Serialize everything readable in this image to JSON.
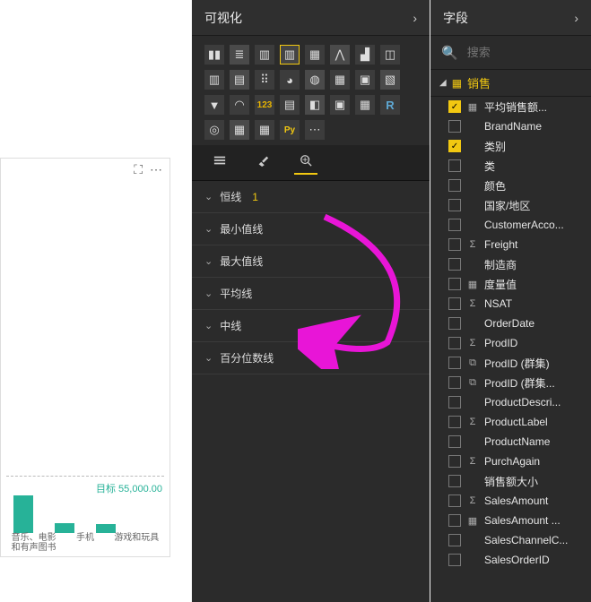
{
  "canvas": {
    "goal_label": "目标 55,000.00",
    "header_icons": [
      "focus-icon",
      "more-icon"
    ],
    "bars": {
      "heights": [
        42,
        11,
        10
      ],
      "labels": [
        "音乐、电影和有声图书",
        "手机",
        "游戏和玩具"
      ]
    }
  },
  "visualizations": {
    "title": "可视化",
    "grid": [
      {
        "n": "stacked-bar-icon",
        "cls": "",
        "g": "▮▮"
      },
      {
        "n": "clustered-bar-icon",
        "cls": "alt1",
        "g": "≣"
      },
      {
        "n": "column-icon",
        "cls": "",
        "g": "▥"
      },
      {
        "n": "stacked-column-icon",
        "cls": "sel",
        "g": "▥"
      },
      {
        "n": "clustered-column-icon",
        "cls": "",
        "g": "▦"
      },
      {
        "n": "line-icon",
        "cls": "alt1",
        "g": "⋀"
      },
      {
        "n": "area-icon",
        "cls": "",
        "g": "▟"
      },
      {
        "n": "combo-icon",
        "cls": "",
        "g": "◫"
      },
      {
        "n": "ribbon-icon",
        "cls": "",
        "g": "▥"
      },
      {
        "n": "waterfall-icon",
        "cls": "alt1",
        "g": "▤"
      },
      {
        "n": "scatter-icon",
        "cls": "",
        "g": "⠿"
      },
      {
        "n": "pie-icon",
        "cls": "",
        "g": "◕"
      },
      {
        "n": "donut-icon",
        "cls": "alt1",
        "g": "◍"
      },
      {
        "n": "treemap-icon",
        "cls": "",
        "g": "▦"
      },
      {
        "n": "map-icon",
        "cls": "",
        "g": "▣"
      },
      {
        "n": "filled-map-icon",
        "cls": "alt1",
        "g": "▧"
      },
      {
        "n": "funnel-icon",
        "cls": "",
        "g": "▼"
      },
      {
        "n": "gauge-icon",
        "cls": "",
        "g": "◠"
      },
      {
        "n": "card-icon",
        "cls": "kpi",
        "g": "123"
      },
      {
        "n": "multicard-icon",
        "cls": "",
        "g": "▤"
      },
      {
        "n": "kpi-icon",
        "cls": "alt1",
        "g": "◧"
      },
      {
        "n": "slicer-icon",
        "cls": "",
        "g": "▣"
      },
      {
        "n": "table-icon",
        "cls": "",
        "g": "▦"
      },
      {
        "n": "matrix-icon",
        "cls": "r",
        "g": "R"
      },
      {
        "n": "globe-icon",
        "cls": "",
        "g": "◎"
      },
      {
        "n": "table2-icon",
        "cls": "alt1",
        "g": "▦"
      },
      {
        "n": "matrix2-icon",
        "cls": "",
        "g": "▦"
      },
      {
        "n": "python-icon",
        "cls": "py",
        "g": "Py"
      },
      {
        "n": "more-visuals-icon",
        "cls": "",
        "g": "⋯"
      }
    ],
    "tabs": [
      {
        "n": "fields-tab",
        "active": false,
        "icon": "list"
      },
      {
        "n": "format-tab",
        "active": false,
        "icon": "brush"
      },
      {
        "n": "analytics-tab",
        "active": true,
        "icon": "magnify"
      }
    ],
    "accordion": [
      {
        "label": "恒线",
        "count": "1"
      },
      {
        "label": "最小值线",
        "count": ""
      },
      {
        "label": "最大值线",
        "count": ""
      },
      {
        "label": "平均线",
        "count": ""
      },
      {
        "label": "中线",
        "count": ""
      },
      {
        "label": "百分位数线",
        "count": ""
      }
    ]
  },
  "fields": {
    "title": "字段",
    "search_placeholder": "搜索",
    "table": "销售",
    "items": [
      {
        "checked": true,
        "icon": "calc",
        "label": "平均销售额..."
      },
      {
        "checked": false,
        "icon": "",
        "label": "BrandName"
      },
      {
        "checked": true,
        "icon": "",
        "label": "类别"
      },
      {
        "checked": false,
        "icon": "",
        "label": "类"
      },
      {
        "checked": false,
        "icon": "",
        "label": "颜色"
      },
      {
        "checked": false,
        "icon": "",
        "label": "国家/地区"
      },
      {
        "checked": false,
        "icon": "",
        "label": "CustomerAcco..."
      },
      {
        "checked": false,
        "icon": "sum",
        "label": "Freight"
      },
      {
        "checked": false,
        "icon": "",
        "label": "制造商"
      },
      {
        "checked": false,
        "icon": "calc",
        "label": "度量值"
      },
      {
        "checked": false,
        "icon": "sum",
        "label": "NSAT"
      },
      {
        "checked": false,
        "icon": "",
        "label": "OrderDate"
      },
      {
        "checked": false,
        "icon": "sum",
        "label": "ProdID"
      },
      {
        "checked": false,
        "icon": "grp",
        "label": "ProdID (群集)"
      },
      {
        "checked": false,
        "icon": "grp",
        "label": "ProdID (群集..."
      },
      {
        "checked": false,
        "icon": "",
        "label": "ProductDescri..."
      },
      {
        "checked": false,
        "icon": "sum",
        "label": "ProductLabel"
      },
      {
        "checked": false,
        "icon": "",
        "label": "ProductName"
      },
      {
        "checked": false,
        "icon": "sum",
        "label": "PurchAgain"
      },
      {
        "checked": false,
        "icon": "",
        "label": "销售额大小"
      },
      {
        "checked": false,
        "icon": "sum",
        "label": "SalesAmount"
      },
      {
        "checked": false,
        "icon": "calc",
        "label": "SalesAmount ..."
      },
      {
        "checked": false,
        "icon": "",
        "label": "SalesChannelC..."
      },
      {
        "checked": false,
        "icon": "",
        "label": "SalesOrderID"
      }
    ]
  }
}
